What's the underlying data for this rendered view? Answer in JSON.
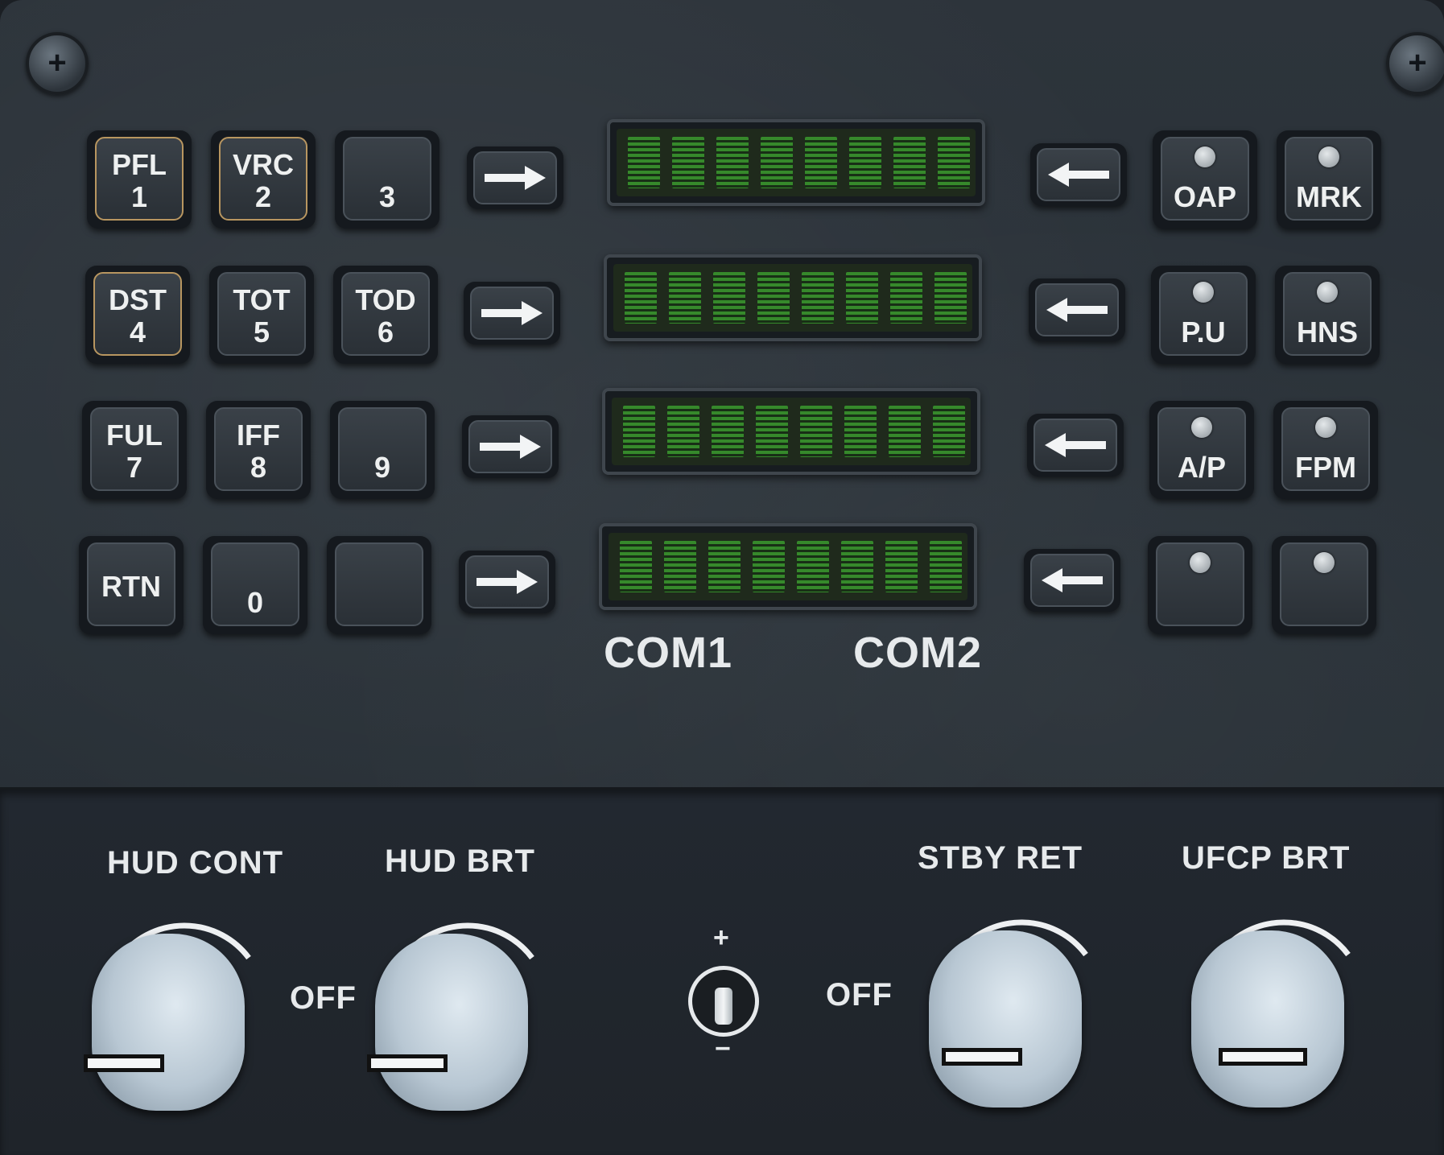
{
  "left_keypad": [
    {
      "top": "PFL",
      "bottom": "1",
      "lit": true
    },
    {
      "top": "VRC",
      "bottom": "2",
      "lit": true
    },
    {
      "top": "",
      "bottom": "3",
      "lit": false
    },
    {
      "top": "DST",
      "bottom": "4",
      "lit": true
    },
    {
      "top": "TOT",
      "bottom": "5",
      "lit": false
    },
    {
      "top": "TOD",
      "bottom": "6",
      "lit": false
    },
    {
      "top": "FUL",
      "bottom": "7",
      "lit": false
    },
    {
      "top": "IFF",
      "bottom": "8",
      "lit": false
    },
    {
      "top": "",
      "bottom": "9",
      "lit": false
    },
    {
      "top": "RTN",
      "bottom": "",
      "lit": false
    },
    {
      "top": "",
      "bottom": "0",
      "lit": false
    },
    {
      "top": "",
      "bottom": "",
      "lit": false
    }
  ],
  "right_keypad": [
    {
      "label": "OAP"
    },
    {
      "label": "MRK"
    },
    {
      "label": "P.U"
    },
    {
      "label": "HNS"
    },
    {
      "label": "A/P"
    },
    {
      "label": "FPM"
    },
    {
      "label": ""
    },
    {
      "label": ""
    }
  ],
  "display_rows": 4,
  "com_labels": {
    "left": "COM1",
    "right": "COM2"
  },
  "knobs": {
    "hud_cont": "HUD CONT",
    "hud_brt": "HUD BRT",
    "stby_ret": "STBY RET",
    "ufcp_brt": "UFCP BRT",
    "off_left": "OFF",
    "off_right": "OFF"
  },
  "toggle": {
    "plus": "+",
    "minus": "−"
  },
  "colors": {
    "display_green": "#3a9a2e",
    "panel": "#2b3238",
    "lit_border": "#b89660"
  }
}
